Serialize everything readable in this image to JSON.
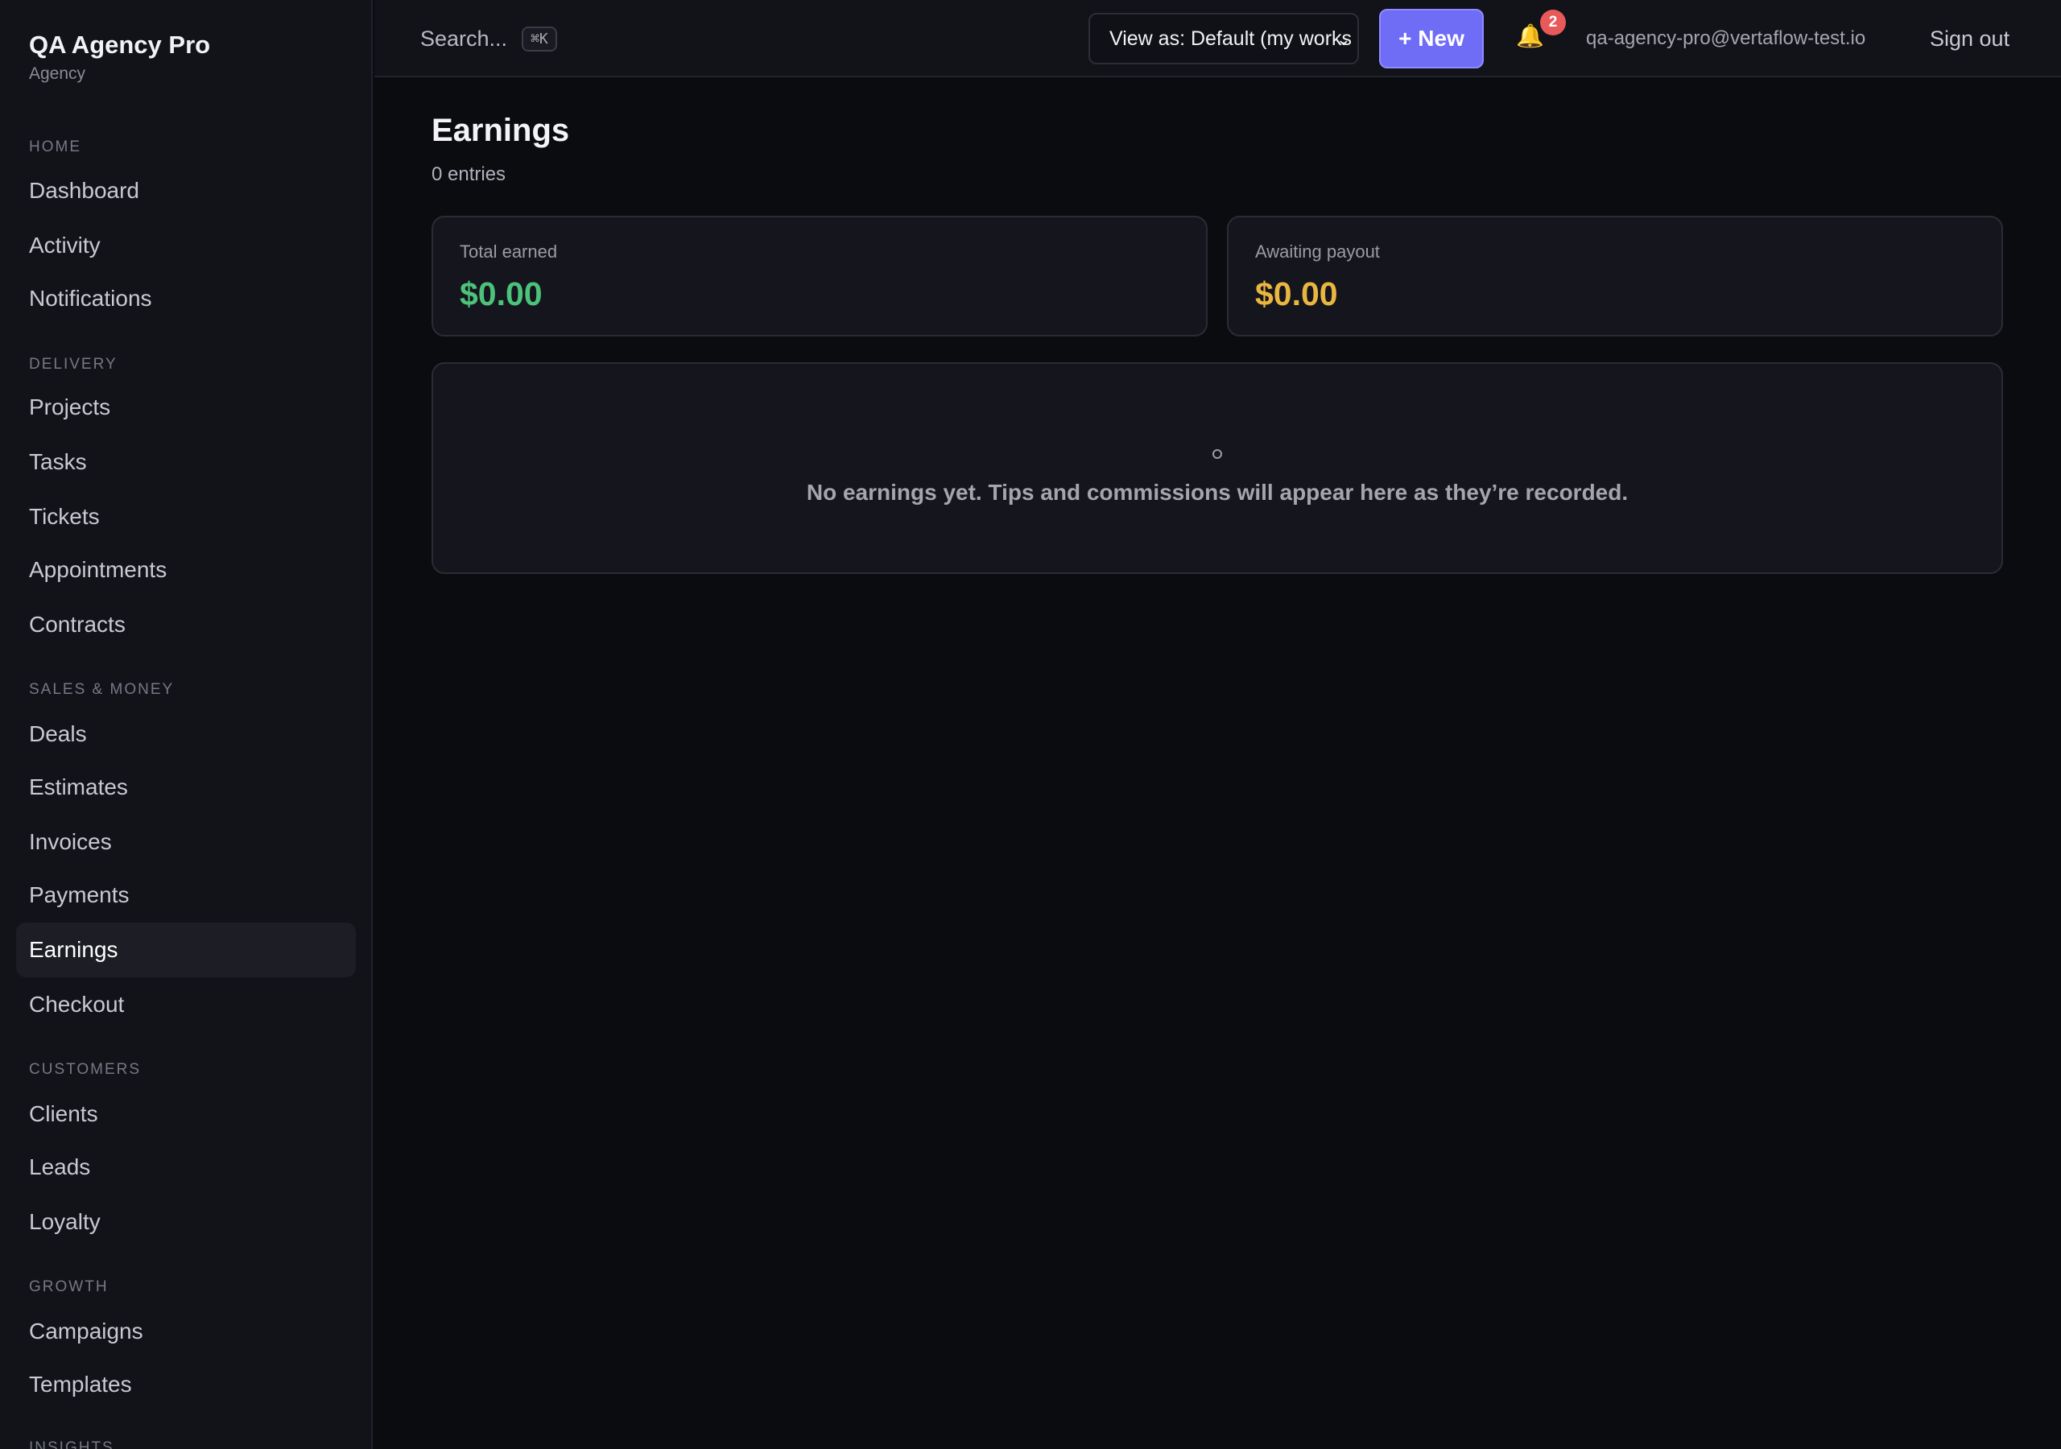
{
  "brand": {
    "title": "QA Agency Pro",
    "subtitle": "Agency"
  },
  "sidebar": {
    "sections": [
      {
        "label": "HOME",
        "items": [
          "Dashboard",
          "Activity",
          "Notifications"
        ]
      },
      {
        "label": "DELIVERY",
        "items": [
          "Projects",
          "Tasks",
          "Tickets",
          "Appointments",
          "Contracts"
        ]
      },
      {
        "label": "SALES & MONEY",
        "items": [
          "Deals",
          "Estimates",
          "Invoices",
          "Payments",
          "Earnings",
          "Checkout"
        ]
      },
      {
        "label": "CUSTOMERS",
        "items": [
          "Clients",
          "Leads",
          "Loyalty"
        ]
      },
      {
        "label": "GROWTH",
        "items": [
          "Campaigns",
          "Templates"
        ]
      },
      {
        "label": "INSIGHTS",
        "items": []
      }
    ],
    "active_item": "Earnings"
  },
  "topbar": {
    "search_label": "Search...",
    "search_shortcut": "⌘K",
    "view_as": "View as: Default (my works",
    "new_button": "+ New",
    "notification_count": "2",
    "user_email": "qa-agency-pro@vertaflow-test.io",
    "sign_out": "Sign out"
  },
  "main": {
    "title": "Earnings",
    "subtitle": "0 entries",
    "stats": [
      {
        "label": "Total earned",
        "value": "$0.00",
        "color": "#4cc27a"
      },
      {
        "label": "Awaiting payout",
        "value": "$0.00",
        "color": "#e9b640"
      }
    ],
    "empty_message": "No earnings yet. Tips and commissions will appear here as they’re recorded."
  }
}
